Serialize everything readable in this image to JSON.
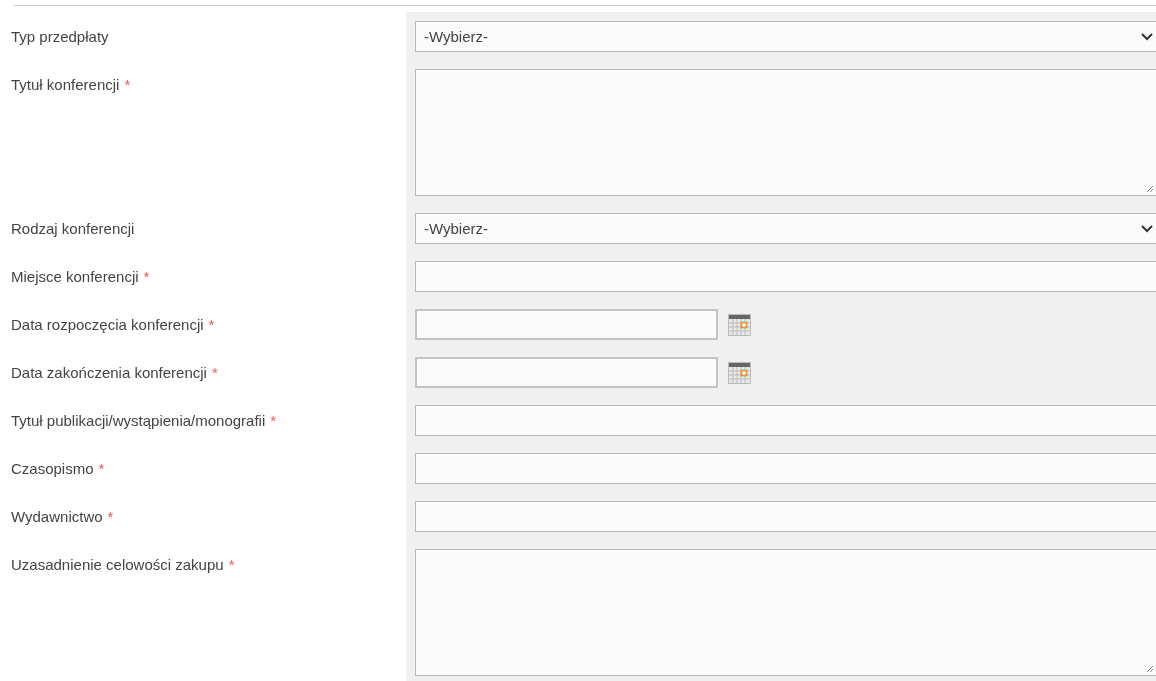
{
  "form": {
    "fields": [
      {
        "kind": "select",
        "label": "Typ przedpłaty",
        "value": "-Wybierz-"
      },
      {
        "kind": "textarea",
        "label": "Tytuł konferencji",
        "required_mark": "*"
      },
      {
        "kind": "select",
        "label": "Rodzaj konferencji",
        "value": "-Wybierz-"
      },
      {
        "kind": "text",
        "label": "Miejsce konferencji",
        "required_mark": "*"
      },
      {
        "kind": "date",
        "label": "Data rozpoczęcia konferencji",
        "required_mark": "*"
      },
      {
        "kind": "date",
        "label": "Data zakończenia konferencji",
        "required_mark": "*"
      },
      {
        "kind": "text",
        "label": "Tytuł publikacji/wystąpienia/monografii",
        "required_mark": "*"
      },
      {
        "kind": "text",
        "label": "Czasopismo",
        "required_mark": "*"
      },
      {
        "kind": "text",
        "label": "Wydawnictwo",
        "required_mark": "*"
      },
      {
        "kind": "textarea",
        "label": "Uzasadnienie celowości zakupu",
        "required_mark": "*"
      }
    ]
  }
}
